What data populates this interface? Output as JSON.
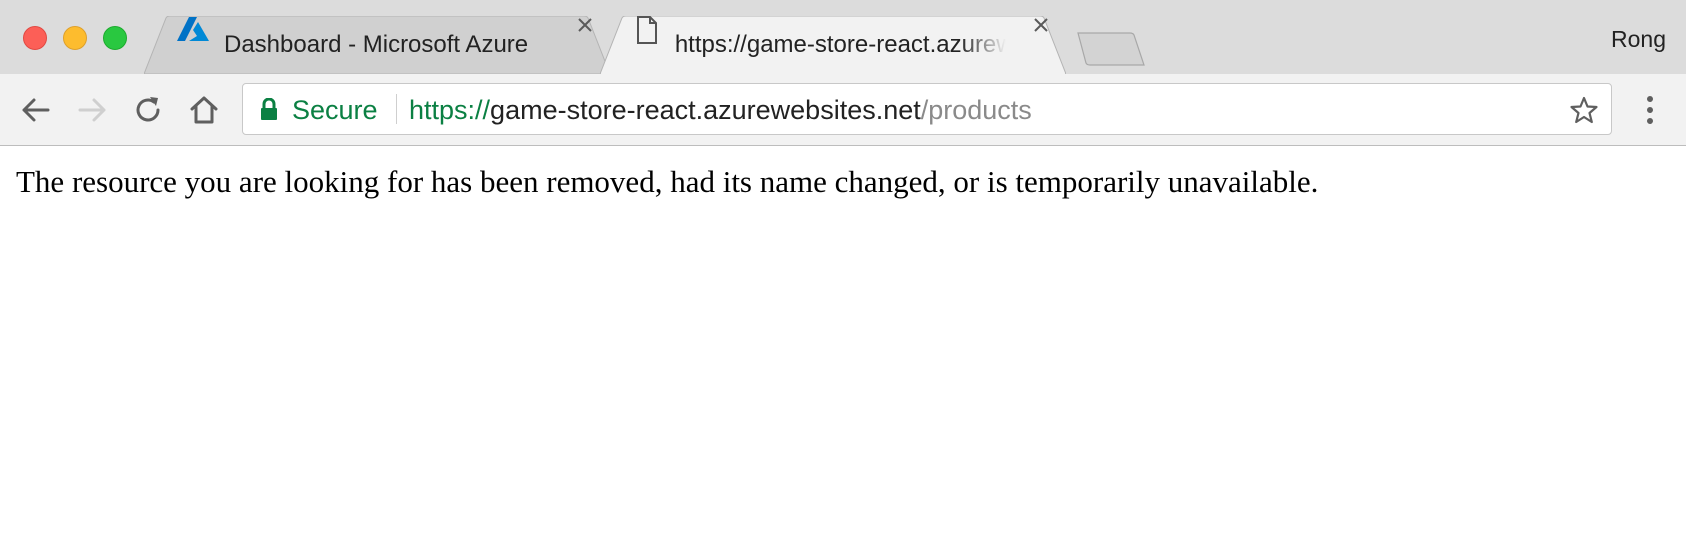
{
  "window": {
    "profile_name": "Rong"
  },
  "tabs": [
    {
      "title": "Dashboard - Microsoft Azure",
      "icon": "azure-logo-icon",
      "active": false
    },
    {
      "title": "https://game-store-react.azurewebsites.net/products",
      "icon": "document-icon",
      "active": true
    }
  ],
  "toolbar": {
    "back_icon": "back-arrow-icon",
    "forward_icon": "forward-arrow-icon",
    "reload_icon": "reload-icon",
    "home_icon": "home-icon",
    "menu_icon": "vertical-dots-icon"
  },
  "omnibox": {
    "security_label": "Secure",
    "url_scheme": "https://",
    "url_host": "game-store-react.azurewebsites.net",
    "url_path": "/products",
    "bookmark_icon": "star-icon"
  },
  "page": {
    "message": "The resource you are looking for has been removed, had its name changed, or is temporarily unavailable."
  },
  "colors": {
    "secure_green": "#0b8043",
    "tabstrip_bg": "#dcdcdc",
    "active_tab_bg": "#f2f2f2",
    "traffic_close": "#fc5f57",
    "traffic_minimize": "#fdbc2e",
    "traffic_maximize": "#29c840"
  }
}
